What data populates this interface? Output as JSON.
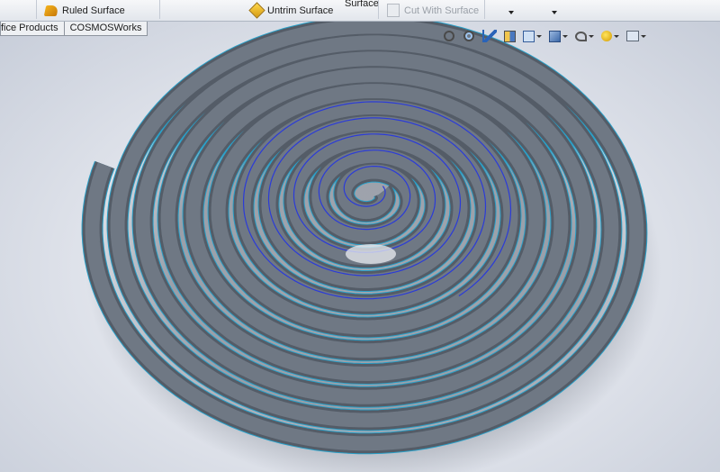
{
  "ribbon": {
    "ruled_surface": "Ruled Surface",
    "untrim_surface": "Untrim Surface",
    "surface_fragment": "Surface",
    "cut_with_surface": "Cut With Surface"
  },
  "tabs": [
    {
      "label": "fice Products"
    },
    {
      "label": "COSMOSWorks"
    }
  ],
  "heads_up_toolbar": {
    "icons": [
      "zoom-to-fit-icon",
      "zoom-to-area-icon",
      "previous-view-icon",
      "section-view-icon",
      "view-orientation-icon",
      "display-style-icon",
      "hide-show-items-icon",
      "apply-scene-icon",
      "view-settings-icon"
    ]
  },
  "model": {
    "name_visible": "",
    "colors": {
      "body": "#6f7884",
      "edge": "#2aa0c8",
      "selected_edge": "#2b3bd8",
      "background_center": "#f7f8fb",
      "background_edge": "#c7cdd9"
    }
  }
}
